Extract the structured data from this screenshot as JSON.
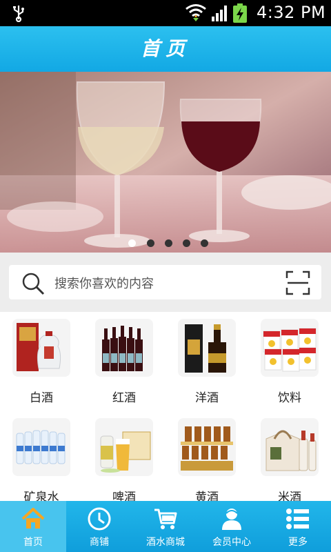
{
  "status_bar": {
    "time": "4:32 PM"
  },
  "header": {
    "title": "首页"
  },
  "banner": {
    "slides": 5,
    "active_slide": 1
  },
  "search": {
    "placeholder": "搜索你喜欢的内容"
  },
  "categories": [
    {
      "label": "白酒"
    },
    {
      "label": "红酒"
    },
    {
      "label": "洋酒"
    },
    {
      "label": "饮料"
    },
    {
      "label": "矿泉水"
    },
    {
      "label": "啤酒"
    },
    {
      "label": "黄酒"
    },
    {
      "label": "米酒"
    }
  ],
  "tabbar": {
    "items": [
      {
        "label": "首页",
        "icon": "home-icon"
      },
      {
        "label": "商铺",
        "icon": "clock-icon"
      },
      {
        "label": "酒水商城",
        "icon": "cart-icon"
      },
      {
        "label": "会员中心",
        "icon": "user-icon"
      },
      {
        "label": "更多",
        "icon": "list-icon"
      }
    ],
    "active_index": 0
  },
  "colors": {
    "accent": "#16aee6",
    "tab_active": "#48c4ee"
  }
}
